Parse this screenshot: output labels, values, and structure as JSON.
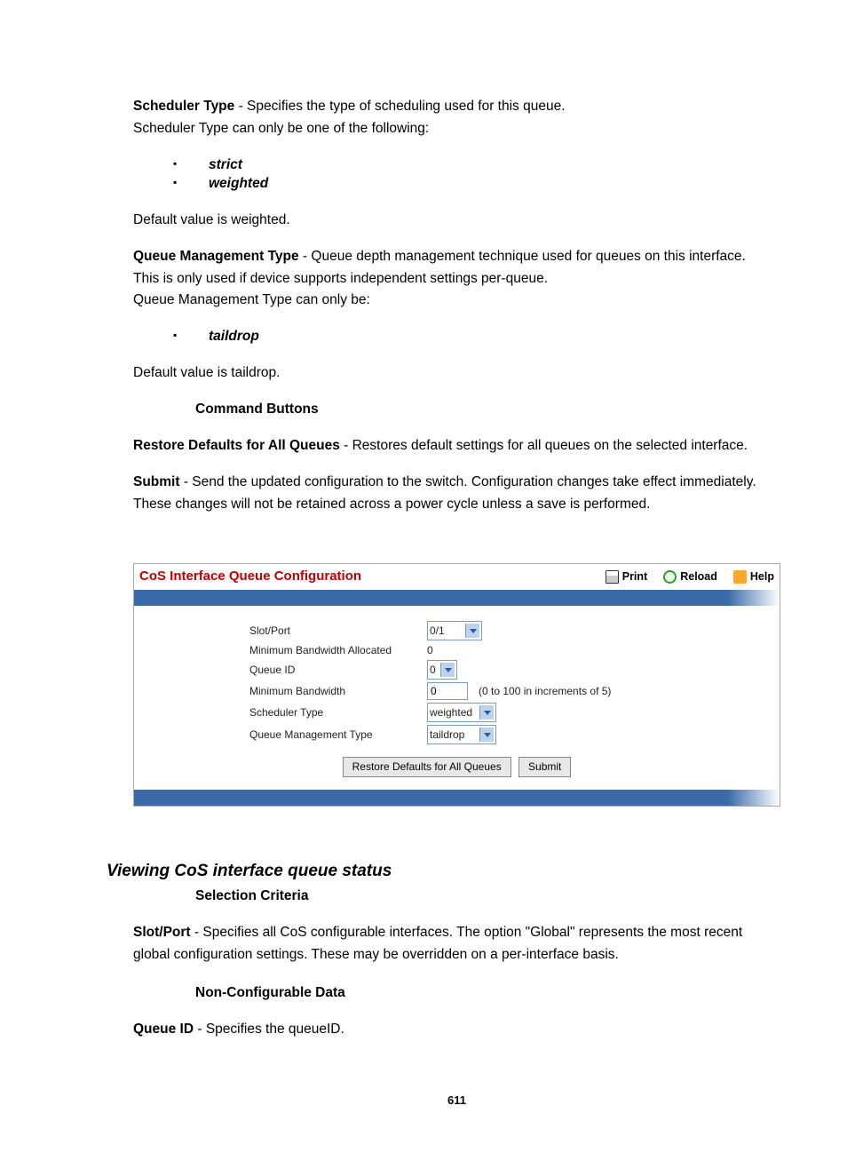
{
  "intro": {
    "scheduler_type_label": "Scheduler Type",
    "scheduler_type_text1": " - Specifies the type of scheduling used for this queue.",
    "scheduler_type_text2": "Scheduler Type can only be one of the following:",
    "bullets_scheduler": [
      "strict",
      "weighted"
    ],
    "default_weighted": "Default value is weighted.",
    "qmt_label": "Queue Management Type",
    "qmt_text1": " - Queue depth management technique used for queues on this interface.",
    "qmt_text2": "This is only used if device supports independent settings per-queue.",
    "qmt_text3": "Queue Management Type can only be:",
    "bullets_qmt": [
      "taildrop"
    ],
    "default_taildrop": "Default value is taildrop.",
    "command_buttons_heading": "Command Buttons",
    "restore_label": "Restore Defaults for All Queues",
    "restore_text": " - Restores default settings for all queues on the selected interface.",
    "submit_label": "Submit",
    "submit_text1": " - Send the updated configuration to the switch. Configuration changes take effect immediately.",
    "submit_text2": "These changes will not be retained across a power cycle unless a save is performed."
  },
  "panel": {
    "title": "CoS Interface Queue Configuration",
    "toolbar": {
      "print": "Print",
      "reload": "Reload",
      "help": "Help"
    },
    "form": {
      "slot_port": {
        "label": "Slot/Port",
        "value": "0/1"
      },
      "min_bw_alloc": {
        "label": "Minimum Bandwidth Allocated",
        "value": "0"
      },
      "queue_id": {
        "label": "Queue ID",
        "value": "0"
      },
      "min_bw": {
        "label": "Minimum Bandwidth",
        "value": "0",
        "hint": "(0 to 100 in increments of 5)"
      },
      "scheduler_type": {
        "label": "Scheduler Type",
        "value": "weighted"
      },
      "qmt": {
        "label": "Queue Management Type",
        "value": "taildrop"
      }
    },
    "buttons": {
      "restore": "Restore Defaults for All Queues",
      "submit": "Submit"
    }
  },
  "section2": {
    "heading": "Viewing CoS interface queue status",
    "selection_criteria": "Selection Criteria",
    "slot_port_label": "Slot/Port",
    "slot_port_text1": " - Specifies all CoS configurable interfaces. The option \"Global\" represents the most recent",
    "slot_port_text2": "global configuration settings. These may be overridden on a per-interface basis.",
    "non_config_data": "Non-Configurable Data",
    "queue_id_label": "Queue ID",
    "queue_id_text": " - Specifies the queueID."
  },
  "page_number": "611"
}
